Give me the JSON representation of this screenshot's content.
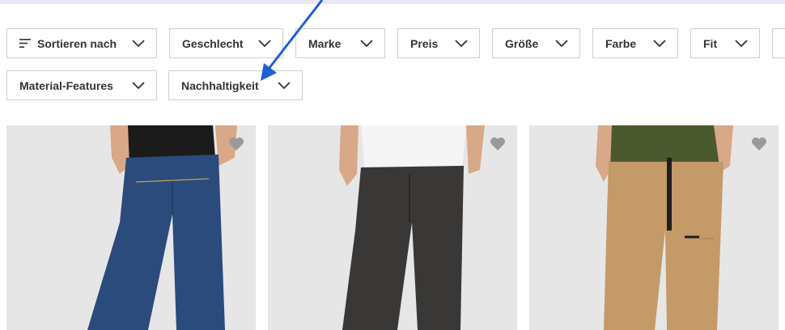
{
  "filters": {
    "sort_label": "Sortieren nach",
    "row1": [
      "Geschlecht",
      "Marke",
      "Preis",
      "Größe",
      "Farbe",
      "Fit"
    ],
    "row2": [
      "Material-Features",
      "Nachhaltigkeit"
    ]
  },
  "products": [
    {
      "icon": "heart-icon",
      "color": "#2b4b7d"
    },
    {
      "icon": "heart-icon",
      "color": "#3a3836"
    },
    {
      "icon": "heart-icon",
      "color": "#c49a68"
    }
  ],
  "colors": {
    "annotation_arrow": "#1f5fd6",
    "heart": "#9a9a9a",
    "card_background": "#e6e6e6"
  }
}
